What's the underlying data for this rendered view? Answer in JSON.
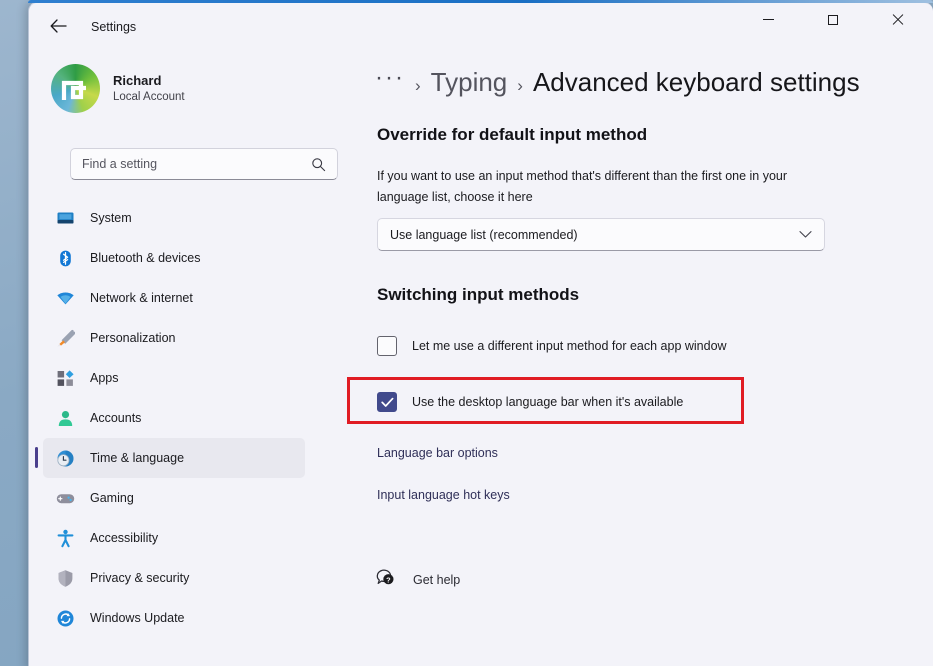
{
  "window": {
    "title": "Settings",
    "back_icon": "back-arrow-icon",
    "controls": {
      "minimize": "minimize-icon",
      "maximize": "maximize-icon",
      "close": "close-icon"
    }
  },
  "sidebar": {
    "account": {
      "name": "Richard",
      "subtitle": "Local Account",
      "avatar_icon": "user-avatar"
    },
    "search": {
      "placeholder": "Find a setting",
      "value": "",
      "icon": "search-icon"
    },
    "items": [
      {
        "label": "System",
        "icon": "system-icon",
        "selected": false
      },
      {
        "label": "Bluetooth & devices",
        "icon": "bluetooth-icon",
        "selected": false
      },
      {
        "label": "Network & internet",
        "icon": "network-icon",
        "selected": false
      },
      {
        "label": "Personalization",
        "icon": "paintbrush-icon",
        "selected": false
      },
      {
        "label": "Apps",
        "icon": "apps-icon",
        "selected": false
      },
      {
        "label": "Accounts",
        "icon": "accounts-icon",
        "selected": false
      },
      {
        "label": "Time & language",
        "icon": "clock-globe-icon",
        "selected": true
      },
      {
        "label": "Gaming",
        "icon": "gamepad-icon",
        "selected": false
      },
      {
        "label": "Accessibility",
        "icon": "accessibility-icon",
        "selected": false
      },
      {
        "label": "Privacy & security",
        "icon": "shield-icon",
        "selected": false
      },
      {
        "label": "Windows Update",
        "icon": "update-icon",
        "selected": false
      }
    ]
  },
  "main": {
    "breadcrumb": {
      "ellipsis": "···",
      "separator": "›",
      "parent": "Typing",
      "current": "Advanced keyboard settings"
    },
    "override_section": {
      "heading": "Override for default input method",
      "description": "If you want to use an input method that's different than the first one in your language list, choose it here",
      "dropdown": {
        "value": "Use language list (recommended)",
        "chevron_icon": "chevron-down-icon",
        "options": [
          "Use language list (recommended)"
        ]
      }
    },
    "switching_section": {
      "heading": "Switching input methods",
      "checkboxes": [
        {
          "label": "Let me use a different input method for each app window",
          "checked": false
        },
        {
          "label": "Use the desktop language bar when it's available",
          "checked": true
        }
      ],
      "links": [
        {
          "label": "Language bar options"
        },
        {
          "label": "Input language hot keys"
        }
      ]
    },
    "get_help": {
      "label": "Get help",
      "icon": "help-question-icon"
    }
  },
  "highlight": {
    "color": "#e01b24"
  },
  "colors": {
    "accent": "#414a8c",
    "selection_bar": "#4a3f8c",
    "window_bg": "#f3f3f9",
    "link": "#2f2f58"
  }
}
